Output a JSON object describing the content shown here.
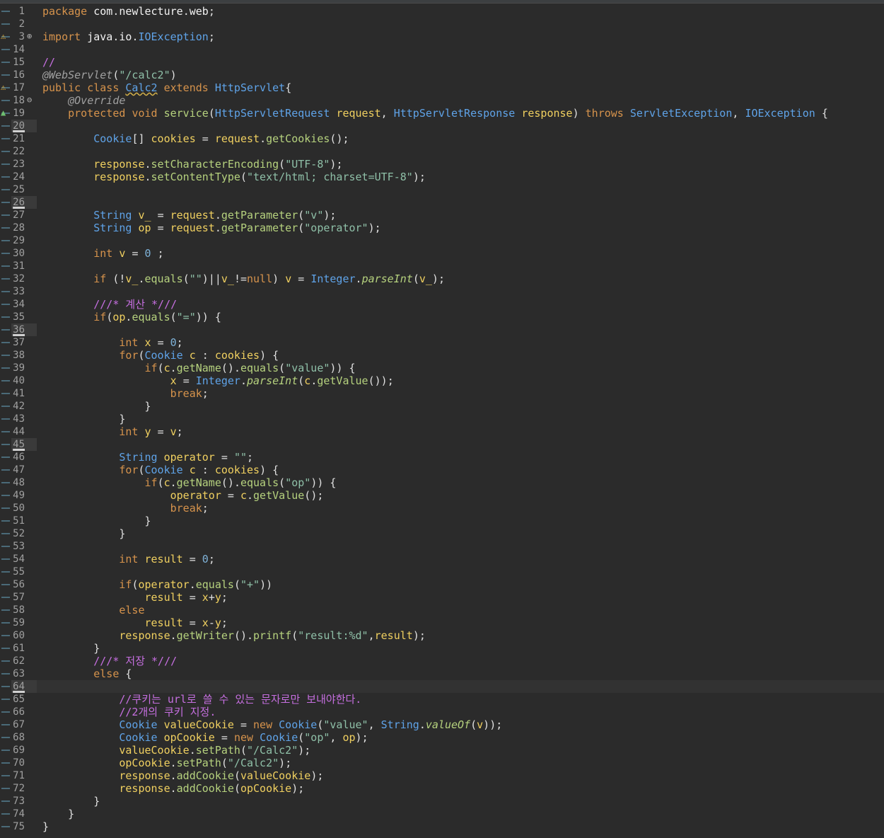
{
  "editor": {
    "file_lines": [
      {
        "n": "1",
        "t": "package com.newlecture.web;"
      },
      {
        "n": "2",
        "t": ""
      },
      {
        "n": "3",
        "t": "import java.io.IOException;"
      },
      {
        "n": "14",
        "t": ""
      },
      {
        "n": "15",
        "t": "//"
      },
      {
        "n": "16",
        "t": "@WebServlet(\"/calc2\")"
      },
      {
        "n": "17",
        "t": "public class Calc2 extends HttpServlet{"
      },
      {
        "n": "18",
        "t": "    @Override"
      },
      {
        "n": "19",
        "t": "    protected void service(HttpServletRequest request, HttpServletResponse response) throws ServletException, IOException {"
      },
      {
        "n": "20",
        "t": ""
      },
      {
        "n": "21",
        "t": "        Cookie[] cookies = request.getCookies();"
      },
      {
        "n": "22",
        "t": ""
      },
      {
        "n": "23",
        "t": "        response.setCharacterEncoding(\"UTF-8\");"
      },
      {
        "n": "24",
        "t": "        response.setContentType(\"text/html; charset=UTF-8\");"
      },
      {
        "n": "25",
        "t": ""
      },
      {
        "n": "26",
        "t": ""
      },
      {
        "n": "27",
        "t": "        String v_ = request.getParameter(\"v\");"
      },
      {
        "n": "28",
        "t": "        String op = request.getParameter(\"operator\");"
      },
      {
        "n": "29",
        "t": ""
      },
      {
        "n": "30",
        "t": "        int v = 0 ;"
      },
      {
        "n": "31",
        "t": ""
      },
      {
        "n": "32",
        "t": "        if (!v_.equals(\"\")||v_!=null) v = Integer.parseInt(v_);"
      },
      {
        "n": "33",
        "t": ""
      },
      {
        "n": "34",
        "t": "        ///* 계산 *///"
      },
      {
        "n": "35",
        "t": "        if(op.equals(\"=\")) {"
      },
      {
        "n": "36",
        "t": ""
      },
      {
        "n": "37",
        "t": "            int x = 0;"
      },
      {
        "n": "38",
        "t": "            for(Cookie c : cookies) {"
      },
      {
        "n": "39",
        "t": "                if(c.getName().equals(\"value\")) {"
      },
      {
        "n": "40",
        "t": "                    x = Integer.parseInt(c.getValue());"
      },
      {
        "n": "41",
        "t": "                    break;"
      },
      {
        "n": "42",
        "t": "                }"
      },
      {
        "n": "43",
        "t": "            }"
      },
      {
        "n": "44",
        "t": "            int y = v;"
      },
      {
        "n": "45",
        "t": ""
      },
      {
        "n": "46",
        "t": "            String operator = \"\";"
      },
      {
        "n": "47",
        "t": "            for(Cookie c : cookies) {"
      },
      {
        "n": "48",
        "t": "                if(c.getName().equals(\"op\")) {"
      },
      {
        "n": "49",
        "t": "                    operator = c.getValue();"
      },
      {
        "n": "50",
        "t": "                    break;"
      },
      {
        "n": "51",
        "t": "                }"
      },
      {
        "n": "52",
        "t": "            }"
      },
      {
        "n": "53",
        "t": ""
      },
      {
        "n": "54",
        "t": "            int result = 0;"
      },
      {
        "n": "55",
        "t": ""
      },
      {
        "n": "56",
        "t": "            if(operator.equals(\"+\"))"
      },
      {
        "n": "57",
        "t": "                result = x+y;"
      },
      {
        "n": "58",
        "t": "            else"
      },
      {
        "n": "59",
        "t": "                result = x-y;"
      },
      {
        "n": "60",
        "t": "            response.getWriter().printf(\"result:%d\",result);"
      },
      {
        "n": "61",
        "t": "        }"
      },
      {
        "n": "62",
        "t": "        ///* 저장 *///"
      },
      {
        "n": "63",
        "t": "        else {"
      },
      {
        "n": "64",
        "t": ""
      },
      {
        "n": "65",
        "t": "            //쿠키는 url로 쓸 수 있는 문자로만 보내야한다."
      },
      {
        "n": "66",
        "t": "            //2개의 쿠키 지정."
      },
      {
        "n": "67",
        "t": "            Cookie valueCookie = new Cookie(\"value\", String.valueOf(v));"
      },
      {
        "n": "68",
        "t": "            Cookie opCookie = new Cookie(\"op\", op);"
      },
      {
        "n": "69",
        "t": "            valueCookie.setPath(\"/Calc2\");"
      },
      {
        "n": "70",
        "t": "            opCookie.setPath(\"/Calc2\");"
      },
      {
        "n": "71",
        "t": "            response.addCookie(valueCookie);"
      },
      {
        "n": "72",
        "t": "            response.addCookie(opCookie);"
      },
      {
        "n": "73",
        "t": "        }"
      },
      {
        "n": "74",
        "t": "    }"
      },
      {
        "n": "75",
        "t": "}"
      }
    ],
    "highlighted_line_numbers": [
      "20",
      "26",
      "36",
      "45",
      "64"
    ],
    "current_line": "64",
    "markers": [
      {
        "line": "3",
        "icon": "warning-icon"
      },
      {
        "line": "3",
        "icon": "expand-fold-icon"
      },
      {
        "line": "17",
        "icon": "warning-icon"
      },
      {
        "line": "18",
        "icon": "collapse-fold-icon"
      },
      {
        "line": "19",
        "icon": "override-triangle-icon"
      }
    ],
    "colors": {
      "background": "#2b2b2b",
      "keyword": "#d6934c",
      "type": "#5fa3e8",
      "string": "#8fc0a8",
      "comment": "#c66fe0",
      "method": "#b6d27e",
      "line_number": "#a0a0a0"
    }
  }
}
